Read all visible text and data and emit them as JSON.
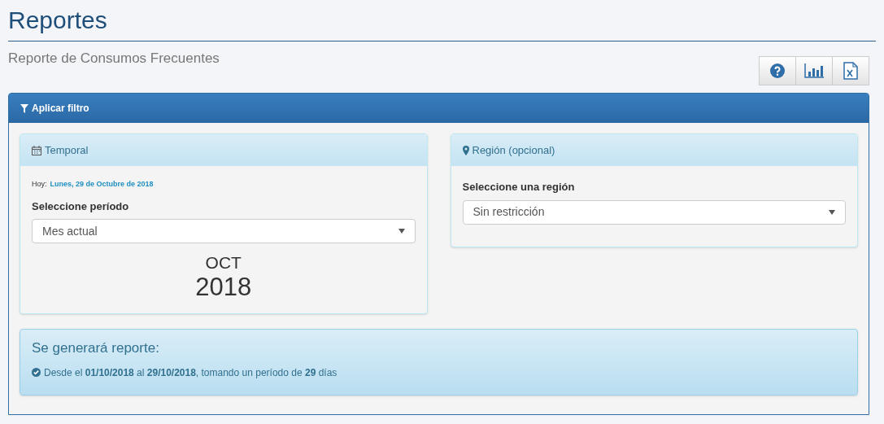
{
  "page": {
    "title": "Reportes",
    "subtitle": "Reporte de Consumos Frecuentes"
  },
  "toolbar": [
    {
      "kind": "help"
    },
    {
      "kind": "chart"
    },
    {
      "kind": "excel"
    }
  ],
  "filter_panel": {
    "title": "Aplicar filtro",
    "temporal": {
      "title": "Temporal",
      "today_label": "Hoy:",
      "today_value": "Lunes, 29 de Octubre de 2018",
      "field_label": "Seleccione período",
      "select_value": "Mes actual",
      "month": "OCT",
      "year": "2018"
    },
    "region": {
      "title": "Región (opcional)",
      "field_label": "Seleccione una región",
      "select_value": "Sin restricción"
    },
    "summary": {
      "title": "Se generará reporte:",
      "text": "Desde el **01/10/2018** al **29/10/2018**, tomando un período de **29** días"
    }
  }
}
